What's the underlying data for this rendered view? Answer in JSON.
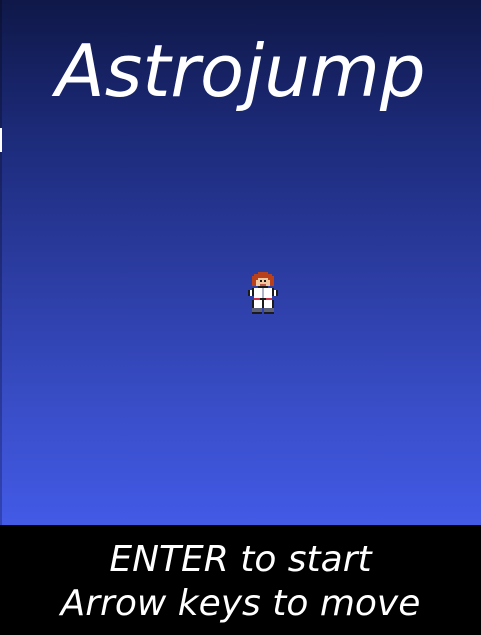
{
  "game": {
    "title": "Astrojump"
  },
  "player": {
    "icon": "astronaut-sprite-icon"
  },
  "instructions": {
    "line1": "ENTER to start",
    "line2": "Arrow keys to move"
  },
  "colors": {
    "sky_top": "#0f1848",
    "sky_bottom": "#425ae6",
    "footer_bg": "#000000",
    "text": "#ffffff"
  }
}
